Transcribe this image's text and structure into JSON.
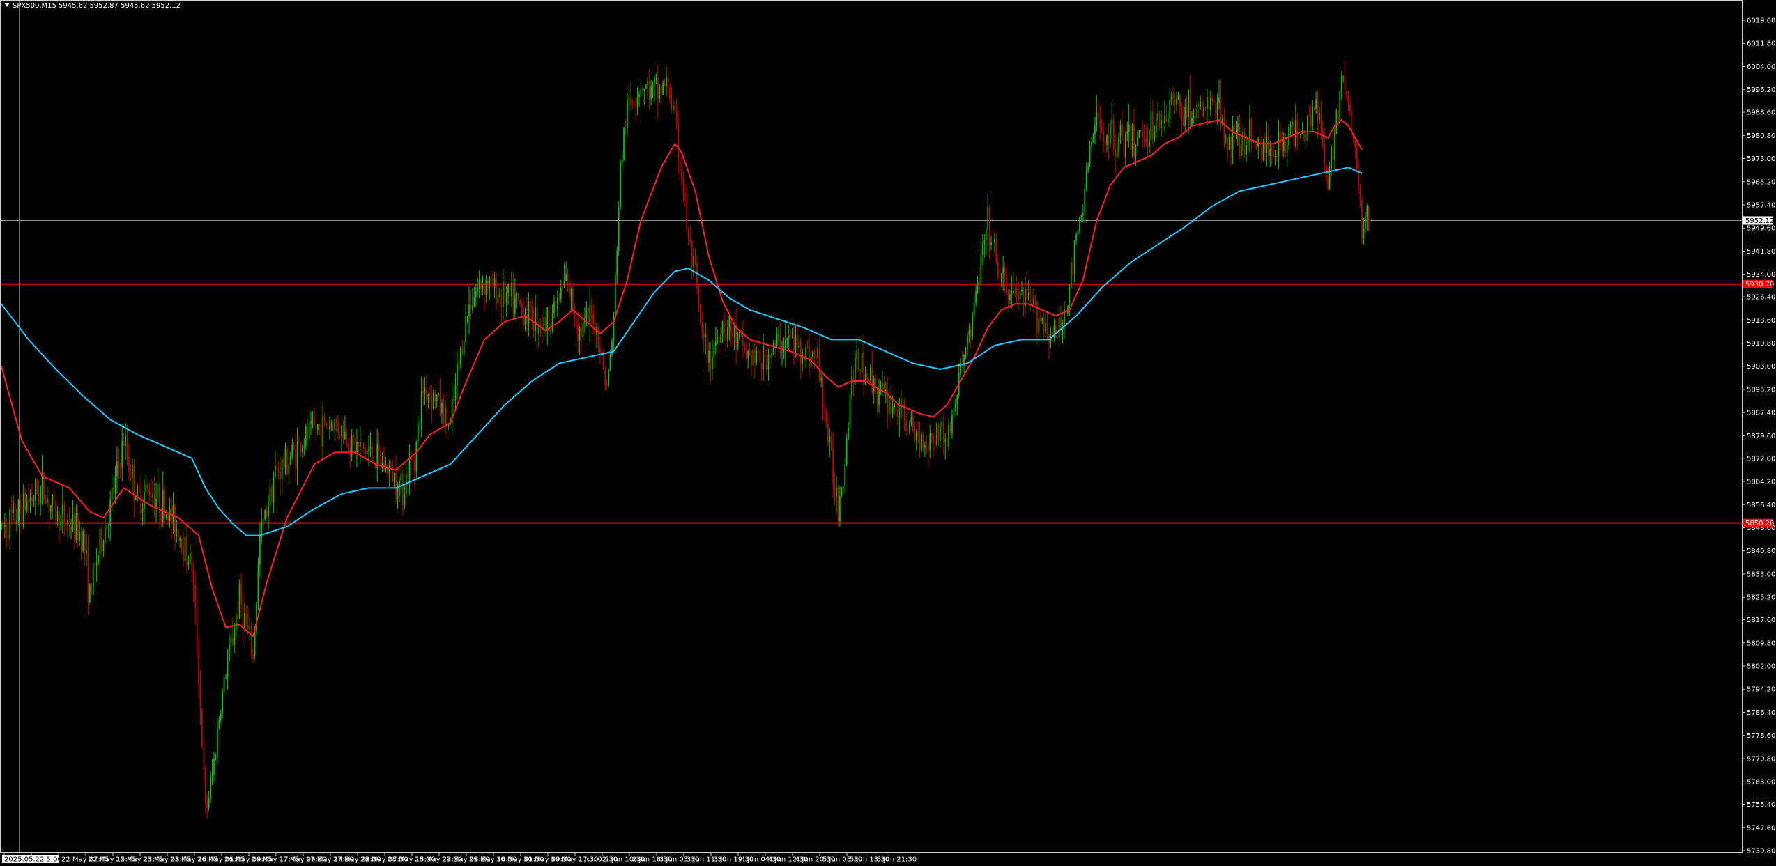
{
  "window": {
    "symbol_line": "SPX500,M15  5945.62 5952.87 5945.62 5952.12"
  },
  "colors": {
    "background": "#000000",
    "bull_candle": "#00c800",
    "bear_candle": "#c80000",
    "ma_fast": "#ff2020",
    "ma_slow": "#1ec8ff",
    "hline": "#ff0000",
    "bid_line": "#8c8c8c",
    "grid_text": "#ffffff"
  },
  "chart_data": {
    "type": "candlestick",
    "timeframe": "M15",
    "symbol": "SPX500",
    "last_price": "5952.12",
    "price_axis": {
      "ylim": [
        5739.8,
        6025.0
      ],
      "ticks": [
        "6019.60",
        "6011.80",
        "6004.00",
        "5996.20",
        "5988.60",
        "5980.80",
        "5973.00",
        "5965.20",
        "5957.40",
        "5949.60",
        "5941.80",
        "5934.00",
        "5926.40",
        "5918.60",
        "5910.80",
        "5903.00",
        "5895.20",
        "5887.40",
        "5879.60",
        "5872.00",
        "5864.20",
        "5856.40",
        "5848.60",
        "5840.80",
        "5833.00",
        "5825.20",
        "5817.60",
        "5809.80",
        "5802.00",
        "5794.20",
        "5786.40",
        "5778.60",
        "5770.80",
        "5763.00",
        "5755.40",
        "5747.60",
        "5739.80"
      ]
    },
    "time_axis": {
      "labels": [
        "2025.05.22 5:00",
        "22 May 07:45",
        "22 May 15:45",
        "22 May 23:45",
        "23 May 08:45",
        "23 May 16:45",
        "26 May 01:45",
        "26 May 09:45",
        "26 May 17:45",
        "27 May 06:30",
        "27 May 14:30",
        "27 May 22:30",
        "28 May 07:30",
        "28 May 15:30",
        "28 May 23:30",
        "29 May 08:30",
        "29 May 16:30",
        "30 May 01:30",
        "30 May 09:30",
        "30 May 17:30",
        "2 Jun 02:30",
        "2 Jun 10:30",
        "2 Jun 18:30",
        "3 Jun 03:30",
        "3 Jun 11:30",
        "3 Jun 19:30",
        "4 Jun 04:30",
        "4 Jun 12:30",
        "4 Jun 20:30",
        "5 Jun 05:30",
        "5 Jun 13:30",
        "5 Jun 21:30"
      ]
    },
    "horizontal_lines": [
      {
        "price": 5930.7,
        "label": "5930.70"
      },
      {
        "price": 5850.2,
        "label": "5850.20"
      }
    ],
    "price_path": [
      [
        0,
        5848
      ],
      [
        2,
        5852
      ],
      [
        4,
        5858
      ],
      [
        6,
        5862
      ],
      [
        8,
        5853
      ],
      [
        10,
        5850
      ],
      [
        12,
        5846
      ],
      [
        13,
        5825
      ],
      [
        14,
        5838
      ],
      [
        16,
        5855
      ],
      [
        18,
        5878
      ],
      [
        19,
        5868
      ],
      [
        20,
        5858
      ],
      [
        22,
        5862
      ],
      [
        24,
        5855
      ],
      [
        26,
        5848
      ],
      [
        28,
        5836
      ],
      [
        29,
        5800
      ],
      [
        30,
        5752
      ],
      [
        31,
        5765
      ],
      [
        32,
        5785
      ],
      [
        33,
        5800
      ],
      [
        34,
        5812
      ],
      [
        35,
        5825
      ],
      [
        36,
        5815
      ],
      [
        37,
        5805
      ],
      [
        38,
        5845
      ],
      [
        40,
        5866
      ],
      [
        43,
        5874
      ],
      [
        46,
        5882
      ],
      [
        49,
        5884
      ],
      [
        52,
        5876
      ],
      [
        54,
        5874
      ],
      [
        57,
        5868
      ],
      [
        59,
        5862
      ],
      [
        61,
        5876
      ],
      [
        62,
        5896
      ],
      [
        64,
        5892
      ],
      [
        66,
        5882
      ],
      [
        67,
        5900
      ],
      [
        68,
        5915
      ],
      [
        69,
        5926
      ],
      [
        71,
        5932
      ],
      [
        73,
        5928
      ],
      [
        75,
        5925
      ],
      [
        78,
        5920
      ],
      [
        80,
        5917
      ],
      [
        82,
        5926
      ],
      [
        83,
        5932
      ],
      [
        85,
        5915
      ],
      [
        87,
        5920
      ],
      [
        88,
        5910
      ],
      [
        89,
        5895
      ],
      [
        90,
        5918
      ],
      [
        91,
        5970
      ],
      [
        92,
        5990
      ],
      [
        94,
        5998
      ],
      [
        96,
        5995
      ],
      [
        98,
        5998
      ],
      [
        99,
        5985
      ],
      [
        100,
        5968
      ],
      [
        101,
        5945
      ],
      [
        102,
        5932
      ],
      [
        103,
        5912
      ],
      [
        104,
        5905
      ],
      [
        106,
        5918
      ],
      [
        108,
        5912
      ],
      [
        110,
        5906
      ],
      [
        112,
        5905
      ],
      [
        114,
        5910
      ],
      [
        116,
        5912
      ],
      [
        118,
        5908
      ],
      [
        120,
        5905
      ],
      [
        121,
        5888
      ],
      [
        122,
        5870
      ],
      [
        123,
        5856
      ],
      [
        124,
        5872
      ],
      [
        125,
        5900
      ],
      [
        126,
        5905
      ],
      [
        128,
        5898
      ],
      [
        130,
        5892
      ],
      [
        132,
        5888
      ],
      [
        134,
        5880
      ],
      [
        136,
        5878
      ],
      [
        138,
        5882
      ],
      [
        139,
        5878
      ],
      [
        140,
        5888
      ],
      [
        141,
        5902
      ],
      [
        142,
        5912
      ],
      [
        143,
        5922
      ],
      [
        144,
        5938
      ],
      [
        145,
        5950
      ],
      [
        146,
        5940
      ],
      [
        147,
        5932
      ],
      [
        148,
        5928
      ],
      [
        150,
        5926
      ],
      [
        152,
        5922
      ],
      [
        154,
        5915
      ],
      [
        155,
        5912
      ],
      [
        156,
        5918
      ],
      [
        157,
        5930
      ],
      [
        158,
        5944
      ],
      [
        159,
        5958
      ],
      [
        160,
        5976
      ],
      [
        161,
        5985
      ],
      [
        162,
        5982
      ],
      [
        164,
        5980
      ],
      [
        166,
        5978
      ],
      [
        168,
        5982
      ],
      [
        170,
        5985
      ],
      [
        172,
        5992
      ],
      [
        174,
        5990
      ],
      [
        176,
        5988
      ],
      [
        178,
        5992
      ],
      [
        179,
        5988
      ],
      [
        180,
        5982
      ],
      [
        182,
        5978
      ],
      [
        184,
        5980
      ],
      [
        186,
        5976
      ],
      [
        188,
        5978
      ],
      [
        190,
        5982
      ],
      [
        192,
        5985
      ],
      [
        193,
        5995
      ],
      [
        194,
        5982
      ],
      [
        195,
        5960
      ],
      [
        196,
        5985
      ],
      [
        197,
        6000
      ],
      [
        198,
        5990
      ],
      [
        199,
        5975
      ],
      [
        200,
        5950
      ],
      [
        201,
        5952
      ]
    ],
    "series": [
      {
        "name": "MA fast",
        "color": "#ff2020",
        "points": [
          [
            0,
            5903
          ],
          [
            3,
            5878
          ],
          [
            6,
            5866
          ],
          [
            10,
            5862
          ],
          [
            13,
            5854
          ],
          [
            15,
            5852
          ],
          [
            18,
            5862
          ],
          [
            22,
            5856
          ],
          [
            26,
            5852
          ],
          [
            29,
            5846
          ],
          [
            31,
            5828
          ],
          [
            33,
            5815
          ],
          [
            35,
            5816
          ],
          [
            37,
            5812
          ],
          [
            39,
            5830
          ],
          [
            42,
            5852
          ],
          [
            46,
            5870
          ],
          [
            49,
            5874
          ],
          [
            52,
            5874
          ],
          [
            55,
            5870
          ],
          [
            58,
            5868
          ],
          [
            61,
            5874
          ],
          [
            63,
            5880
          ],
          [
            66,
            5884
          ],
          [
            68,
            5896
          ],
          [
            71,
            5912
          ],
          [
            74,
            5918
          ],
          [
            77,
            5920
          ],
          [
            80,
            5915
          ],
          [
            82,
            5918
          ],
          [
            84,
            5922
          ],
          [
            86,
            5918
          ],
          [
            88,
            5914
          ],
          [
            90,
            5918
          ],
          [
            92,
            5932
          ],
          [
            94,
            5952
          ],
          [
            97,
            5970
          ],
          [
            99,
            5978
          ],
          [
            100,
            5975
          ],
          [
            102,
            5962
          ],
          [
            104,
            5940
          ],
          [
            106,
            5925
          ],
          [
            108,
            5916
          ],
          [
            110,
            5912
          ],
          [
            113,
            5910
          ],
          [
            116,
            5908
          ],
          [
            119,
            5905
          ],
          [
            121,
            5900
          ],
          [
            123,
            5896
          ],
          [
            125,
            5898
          ],
          [
            127,
            5898
          ],
          [
            130,
            5894
          ],
          [
            132,
            5890
          ],
          [
            135,
            5887
          ],
          [
            137,
            5886
          ],
          [
            139,
            5890
          ],
          [
            141,
            5898
          ],
          [
            143,
            5906
          ],
          [
            145,
            5916
          ],
          [
            147,
            5922
          ],
          [
            149,
            5924
          ],
          [
            151,
            5924
          ],
          [
            153,
            5922
          ],
          [
            155,
            5920
          ],
          [
            157,
            5922
          ],
          [
            159,
            5932
          ],
          [
            161,
            5952
          ],
          [
            163,
            5964
          ],
          [
            165,
            5970
          ],
          [
            167,
            5972
          ],
          [
            169,
            5974
          ],
          [
            171,
            5978
          ],
          [
            173,
            5980
          ],
          [
            175,
            5984
          ],
          [
            177,
            5985
          ],
          [
            179,
            5986
          ],
          [
            181,
            5982
          ],
          [
            183,
            5980
          ],
          [
            185,
            5978
          ],
          [
            187,
            5978
          ],
          [
            189,
            5980
          ],
          [
            191,
            5982
          ],
          [
            193,
            5982
          ],
          [
            195,
            5980
          ],
          [
            196,
            5984
          ],
          [
            197,
            5986
          ],
          [
            198,
            5984
          ],
          [
            200,
            5976
          ]
        ]
      },
      {
        "name": "MA slow",
        "color": "#1ec8ff",
        "points": [
          [
            0,
            5924
          ],
          [
            4,
            5912
          ],
          [
            8,
            5902
          ],
          [
            12,
            5893
          ],
          [
            16,
            5885
          ],
          [
            20,
            5880
          ],
          [
            24,
            5876
          ],
          [
            28,
            5872
          ],
          [
            30,
            5862
          ],
          [
            32,
            5855
          ],
          [
            34,
            5850
          ],
          [
            36,
            5846
          ],
          [
            38,
            5846
          ],
          [
            42,
            5849
          ],
          [
            46,
            5855
          ],
          [
            50,
            5860
          ],
          [
            54,
            5862
          ],
          [
            58,
            5862
          ],
          [
            62,
            5866
          ],
          [
            66,
            5870
          ],
          [
            70,
            5880
          ],
          [
            74,
            5890
          ],
          [
            78,
            5898
          ],
          [
            82,
            5904
          ],
          [
            86,
            5906
          ],
          [
            90,
            5908
          ],
          [
            93,
            5918
          ],
          [
            96,
            5928
          ],
          [
            99,
            5935
          ],
          [
            101,
            5936
          ],
          [
            104,
            5932
          ],
          [
            107,
            5926
          ],
          [
            110,
            5922
          ],
          [
            114,
            5919
          ],
          [
            118,
            5916
          ],
          [
            122,
            5912
          ],
          [
            126,
            5912
          ],
          [
            130,
            5908
          ],
          [
            134,
            5904
          ],
          [
            138,
            5902
          ],
          [
            142,
            5904
          ],
          [
            146,
            5910
          ],
          [
            150,
            5912
          ],
          [
            154,
            5912
          ],
          [
            158,
            5920
          ],
          [
            162,
            5930
          ],
          [
            166,
            5938
          ],
          [
            170,
            5944
          ],
          [
            174,
            5950
          ],
          [
            178,
            5957
          ],
          [
            182,
            5962
          ],
          [
            186,
            5964
          ],
          [
            190,
            5966
          ],
          [
            194,
            5968
          ],
          [
            198,
            5970
          ],
          [
            200,
            5968
          ]
        ]
      }
    ]
  }
}
